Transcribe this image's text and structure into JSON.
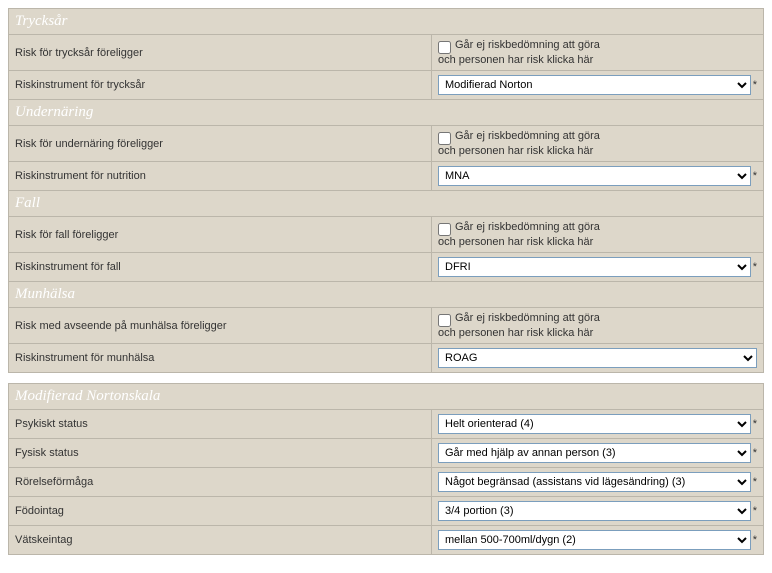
{
  "sections": {
    "trycksar": {
      "header": "Trycksår",
      "risk_label": "Risk för trycksår föreligger",
      "checkbox_line1": "Går ej riskbedömning att göra",
      "checkbox_line2": "och personen har risk klicka här",
      "instrument_label": "Riskinstrument för trycksår",
      "instrument_value": "Modifierad Norton"
    },
    "undernaring": {
      "header": "Undernäring",
      "risk_label": "Risk för undernäring föreligger",
      "checkbox_line1": "Går ej riskbedömning att göra",
      "checkbox_line2": "och personen har risk klicka här",
      "instrument_label": "Riskinstrument för nutrition",
      "instrument_value": "MNA"
    },
    "fall": {
      "header": "Fall",
      "risk_label": "Risk för fall föreligger",
      "checkbox_line1": "Går ej riskbedömning att göra",
      "checkbox_line2": "och personen har risk klicka här",
      "instrument_label": "Riskinstrument för fall",
      "instrument_value": "DFRI"
    },
    "munhalsa": {
      "header": "Munhälsa",
      "risk_label": "Risk med avseende på munhälsa föreligger",
      "checkbox_line1": "Går ej riskbedömning att göra",
      "checkbox_line2": "och personen har risk klicka här",
      "instrument_label": "Riskinstrument för munhälsa",
      "instrument_value": "ROAG"
    }
  },
  "norton": {
    "header": "Modifierad Nortonskala",
    "items": [
      {
        "label": "Psykiskt status",
        "value": "Helt orienterad (4)"
      },
      {
        "label": "Fysisk status",
        "value": "Går med hjälp av annan person (3)"
      },
      {
        "label": "Rörelseförmåga",
        "value": "Något begränsad (assistans vid lägesändring) (3)"
      },
      {
        "label": "Födointag",
        "value": "3/4 portion (3)"
      },
      {
        "label": "Vätskeintag",
        "value": "mellan 500-700ml/dygn (2)"
      }
    ]
  },
  "glyphs": {
    "star": "*"
  }
}
